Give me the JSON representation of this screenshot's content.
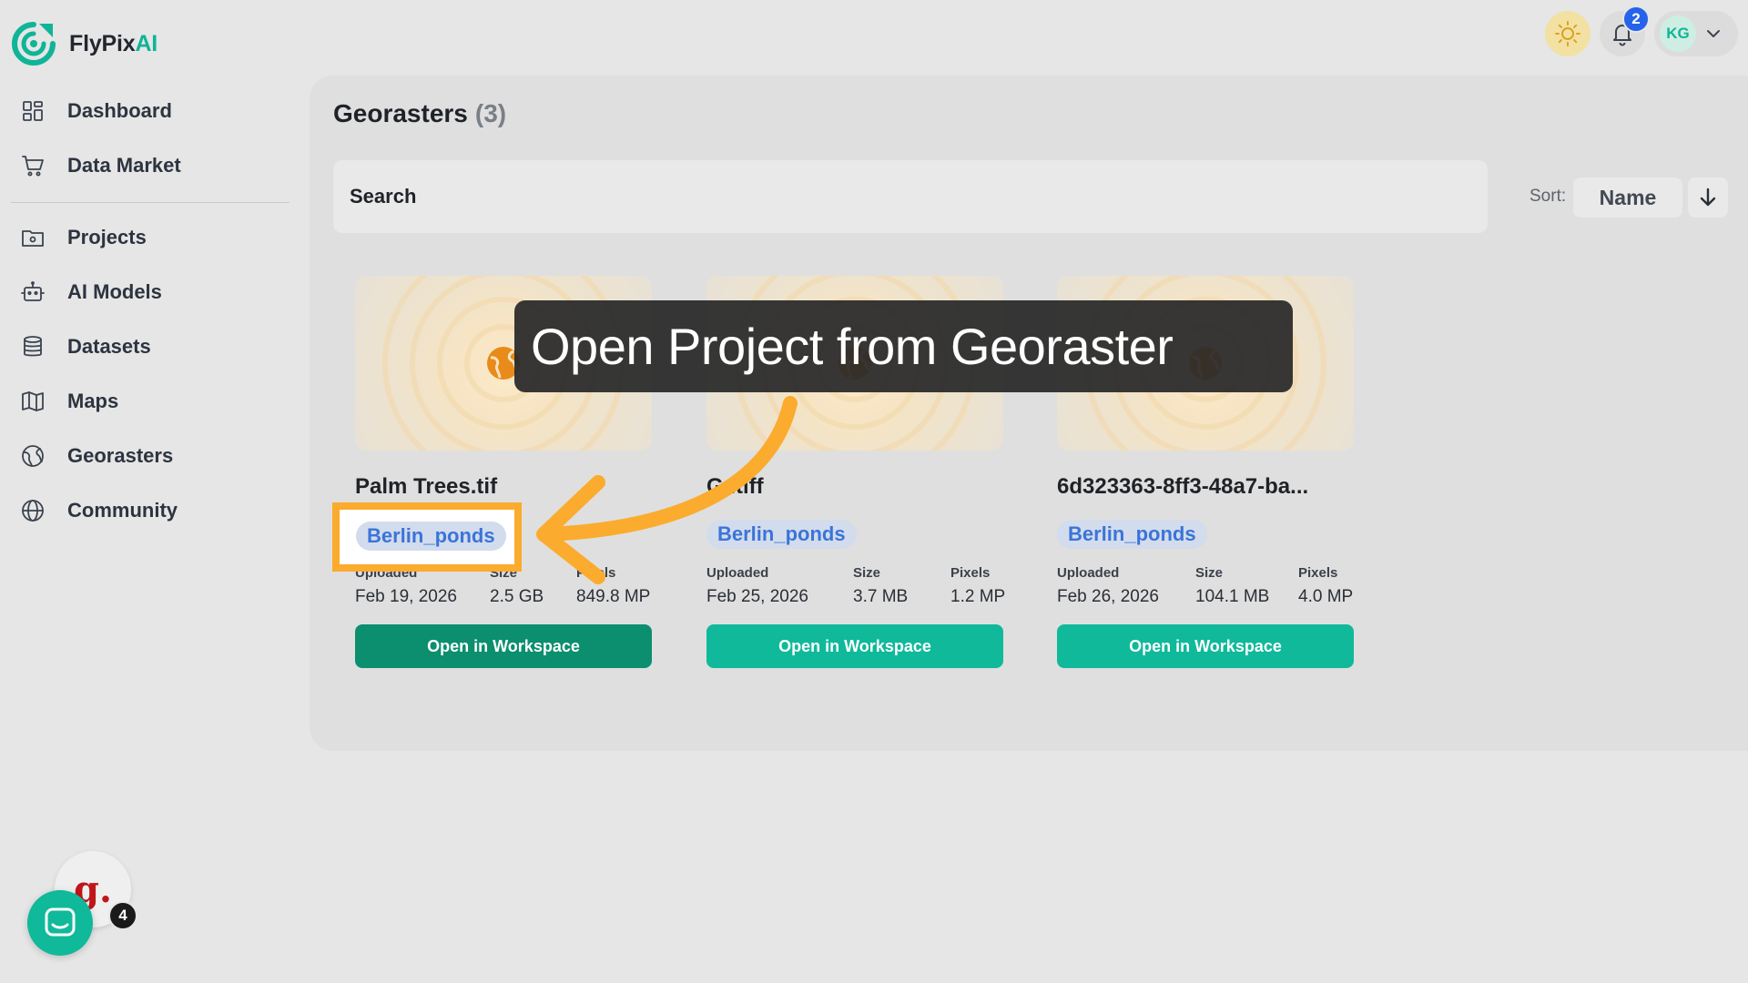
{
  "brand": {
    "name_main": "FlyPix",
    "name_accent": "AI",
    "accent_color": "#10b497",
    "logo_icon": "flypix-logo-icon"
  },
  "sidebar": {
    "primary": [
      {
        "label": "Dashboard",
        "icon": "dashboard-icon"
      },
      {
        "label": "Data Market",
        "icon": "cart-icon"
      }
    ],
    "secondary": [
      {
        "label": "Projects",
        "icon": "folder-icon"
      },
      {
        "label": "AI Models",
        "icon": "robot-icon"
      },
      {
        "label": "Datasets",
        "icon": "database-icon"
      },
      {
        "label": "Maps",
        "icon": "map-icon"
      },
      {
        "label": "Georasters",
        "icon": "georaster-icon"
      },
      {
        "label": "Community",
        "icon": "globe-icon"
      }
    ]
  },
  "header": {
    "theme_icon": "sun-icon",
    "notifications_count": "2",
    "user_initials": "KG",
    "badge_color": "#2563eb"
  },
  "main": {
    "title": "Georasters",
    "count": "(3)",
    "search_placeholder": "Search",
    "sort_label": "Sort:",
    "sort_value": "Name",
    "sort_direction_icon": "arrow-down-icon"
  },
  "meta_labels": {
    "uploaded": "Uploaded",
    "size": "Size",
    "pixels": "Pixels"
  },
  "cards": [
    {
      "name": "Palm Trees.tif",
      "tag": "Berlin_ponds",
      "uploaded": "Feb 19, 2026",
      "size": "2.5 GB",
      "pixels": "849.8 MP",
      "button": "Open in Workspace"
    },
    {
      "name": "G  .tiff",
      "tag": "Berlin_ponds",
      "uploaded": "Feb 25, 2026",
      "size": "3.7 MB",
      "pixels": "1.2 MP",
      "button": "Open in Workspace"
    },
    {
      "name": "6d323363-8ff3-48a7-ba...",
      "tag": "Berlin_ponds",
      "uploaded": "Feb 26, 2026",
      "size": "104.1 MB",
      "pixels": "4.0 MP",
      "button": "Open in Workspace"
    }
  ],
  "overlay": {
    "tooltip": "Open Project from Georaster",
    "highlight_color": "#fbab2d"
  },
  "widgets": {
    "g_logo": "g.",
    "chat_badge": "4",
    "chat_icon": "chat-icon"
  }
}
